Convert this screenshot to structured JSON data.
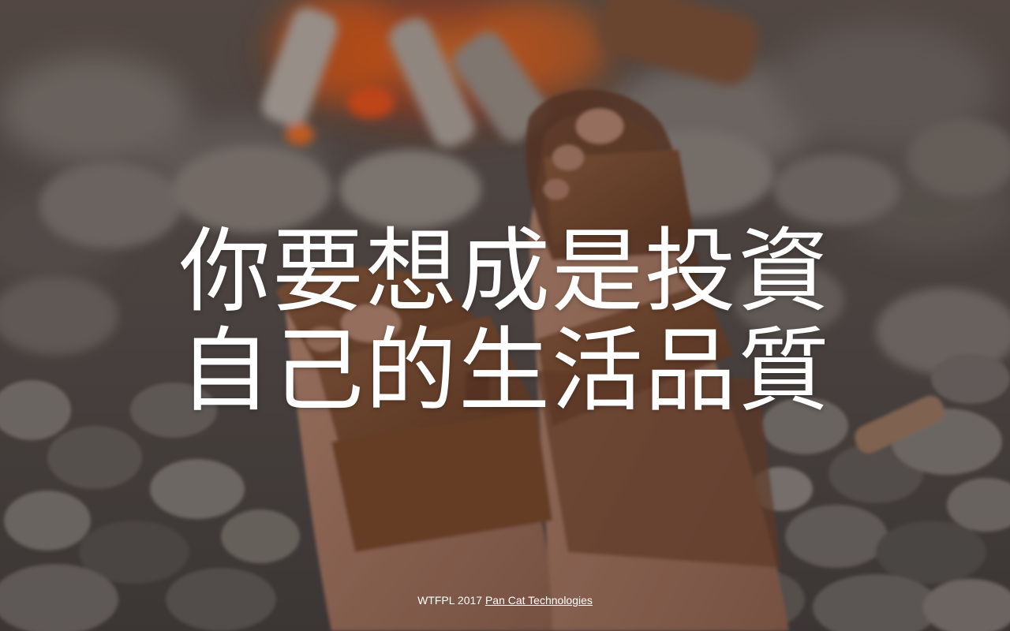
{
  "hero": {
    "headline_line1": "你要想成是投資",
    "headline_line2": "自己的生活品質"
  },
  "footer": {
    "license_text": "WTFPL 2017",
    "company_link": "Pan Cat Technologies"
  },
  "colors": {
    "text": "#ffffff",
    "fire": "#ff6a1a",
    "leather": "#8a5535",
    "pebble": "#7d7670"
  },
  "background": {
    "description_icon": "campfire-sandals-photo"
  }
}
